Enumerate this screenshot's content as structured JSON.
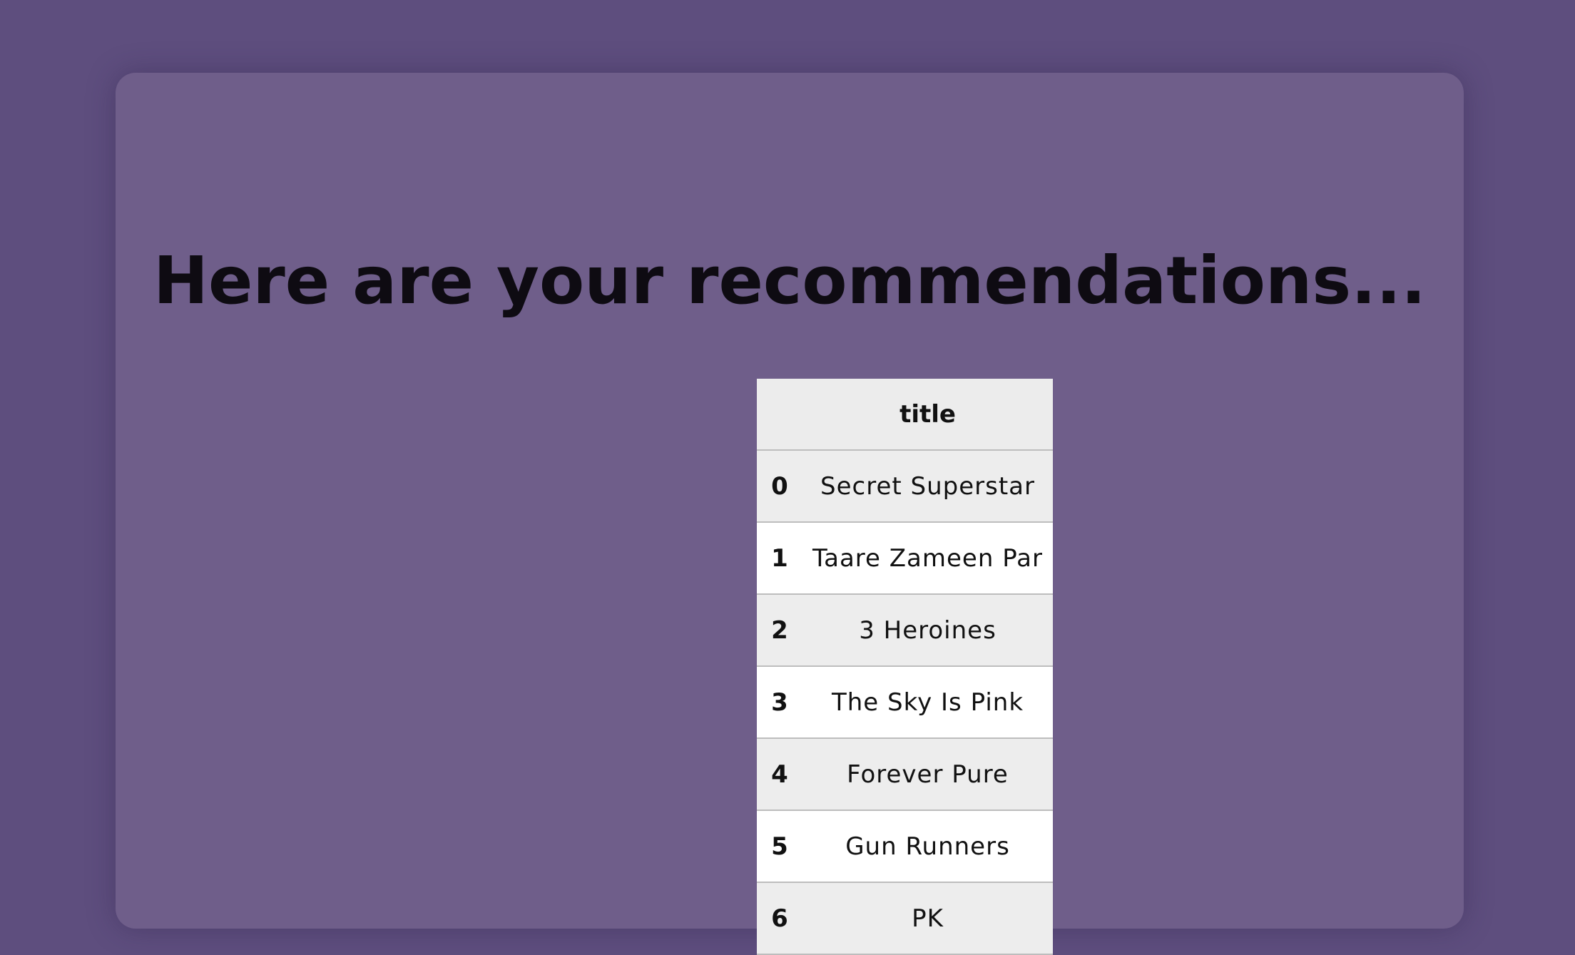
{
  "page": {
    "heading": "Here are your recommendations..."
  },
  "table": {
    "index_header": "",
    "title_header": "title",
    "rows": [
      {
        "index": "0",
        "title": "Secret Superstar"
      },
      {
        "index": "1",
        "title": "Taare Zameen Par"
      },
      {
        "index": "2",
        "title": "3 Heroines"
      },
      {
        "index": "3",
        "title": "The Sky Is Pink"
      },
      {
        "index": "4",
        "title": "Forever Pure"
      },
      {
        "index": "5",
        "title": "Gun Runners"
      },
      {
        "index": "6",
        "title": "PK"
      }
    ]
  },
  "colors": {
    "page_background": "#5e4e7e",
    "card_background": "#6f5e8a",
    "row_odd": "#ededed",
    "row_even": "#ffffff"
  }
}
